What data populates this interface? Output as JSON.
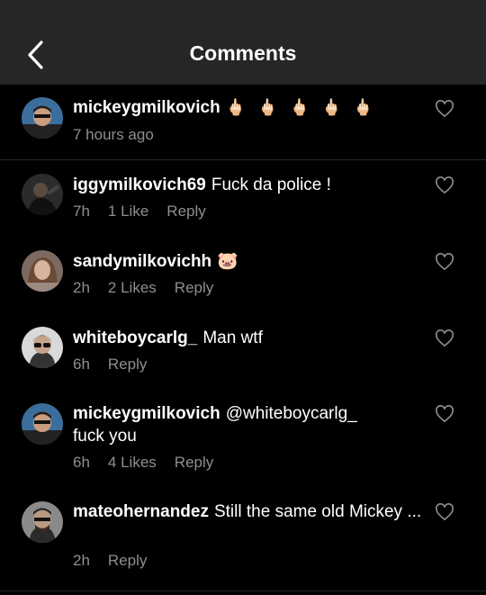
{
  "header": {
    "title": "Comments"
  },
  "comments": [
    {
      "username": "mickeygmilkovich",
      "text": "🖕🏻 🖕🏻 🖕🏻 🖕🏻 🖕🏻",
      "time": "7 hours ago",
      "likes": "",
      "reply": ""
    },
    {
      "username": "iggymilkovich69",
      "text": "Fuck da police !",
      "time": "7h",
      "likes": "1 Like",
      "reply": "Reply"
    },
    {
      "username": "sandymilkovichh",
      "text": "🐷",
      "time": "2h",
      "likes": "2 Likes",
      "reply": "Reply"
    },
    {
      "username": "whiteboycarlg_",
      "text": "Man wtf",
      "time": "6h",
      "likes": "",
      "reply": "Reply"
    },
    {
      "username": "mickeygmilkovich",
      "mention": "@whiteboycarlg_",
      "text": "fuck you",
      "time": "6h",
      "likes": "4 Likes",
      "reply": "Reply"
    },
    {
      "username": "mateohernandez",
      "text": "Still the same old Mickey ...",
      "time": "2h",
      "likes": "",
      "reply": "Reply"
    }
  ],
  "colors": {
    "background": "#000000",
    "header": "#262626",
    "meta": "#8e8e8e"
  }
}
